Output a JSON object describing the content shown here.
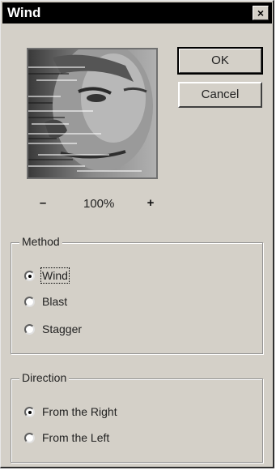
{
  "window": {
    "title": "Wind",
    "close_glyph": "×"
  },
  "buttons": {
    "ok": "OK",
    "cancel": "Cancel"
  },
  "zoom": {
    "minus": "–",
    "value": "100%",
    "plus": "+"
  },
  "method": {
    "legend": "Method",
    "options": [
      "Wind",
      "Blast",
      "Stagger"
    ],
    "selected": "Wind"
  },
  "direction": {
    "legend": "Direction",
    "options": [
      "From the Right",
      "From the Left"
    ],
    "selected": "From the Right"
  }
}
